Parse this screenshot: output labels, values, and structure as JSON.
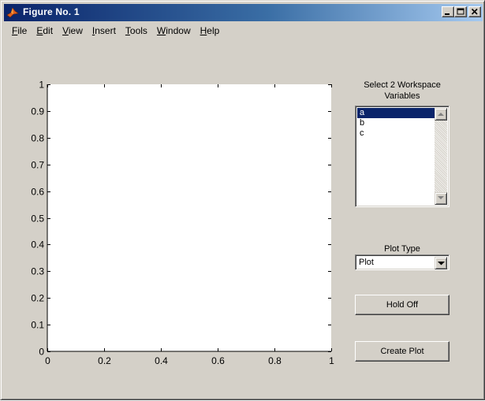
{
  "window": {
    "title": "Figure No. 1",
    "controls": [
      "minimize-icon",
      "maximize-icon",
      "close-icon"
    ]
  },
  "menubar": {
    "items": [
      {
        "label": "File",
        "mnemonic": "F"
      },
      {
        "label": "Edit",
        "mnemonic": "E"
      },
      {
        "label": "View",
        "mnemonic": "V"
      },
      {
        "label": "Insert",
        "mnemonic": "I"
      },
      {
        "label": "Tools",
        "mnemonic": "T"
      },
      {
        "label": "Window",
        "mnemonic": "W"
      },
      {
        "label": "Help",
        "mnemonic": "H"
      }
    ]
  },
  "panel": {
    "listbox_label_line1": "Select 2 Workspace",
    "listbox_label_line2": "Variables",
    "variables": [
      "a",
      "b",
      "c"
    ],
    "selected_variable": "a",
    "plot_type_label": "Plot Type",
    "plot_type_value": "Plot",
    "hold_button_label": "Hold Off",
    "create_button_label": "Create Plot"
  },
  "chart_data": {
    "type": "line",
    "series": [],
    "xlim": [
      0,
      1
    ],
    "ylim": [
      0,
      1
    ],
    "xticks": [
      "0",
      "0.2",
      "0.4",
      "0.6",
      "0.8",
      "1"
    ],
    "yticks": [
      "0",
      "0.1",
      "0.2",
      "0.3",
      "0.4",
      "0.5",
      "0.6",
      "0.7",
      "0.8",
      "0.9",
      "1"
    ],
    "grid": false,
    "background": "#ffffff"
  },
  "colors": {
    "window_face": "#d4d0c8",
    "titlebar_start": "#0a246a",
    "titlebar_end": "#a6caf0",
    "selection": "#0a246a"
  }
}
